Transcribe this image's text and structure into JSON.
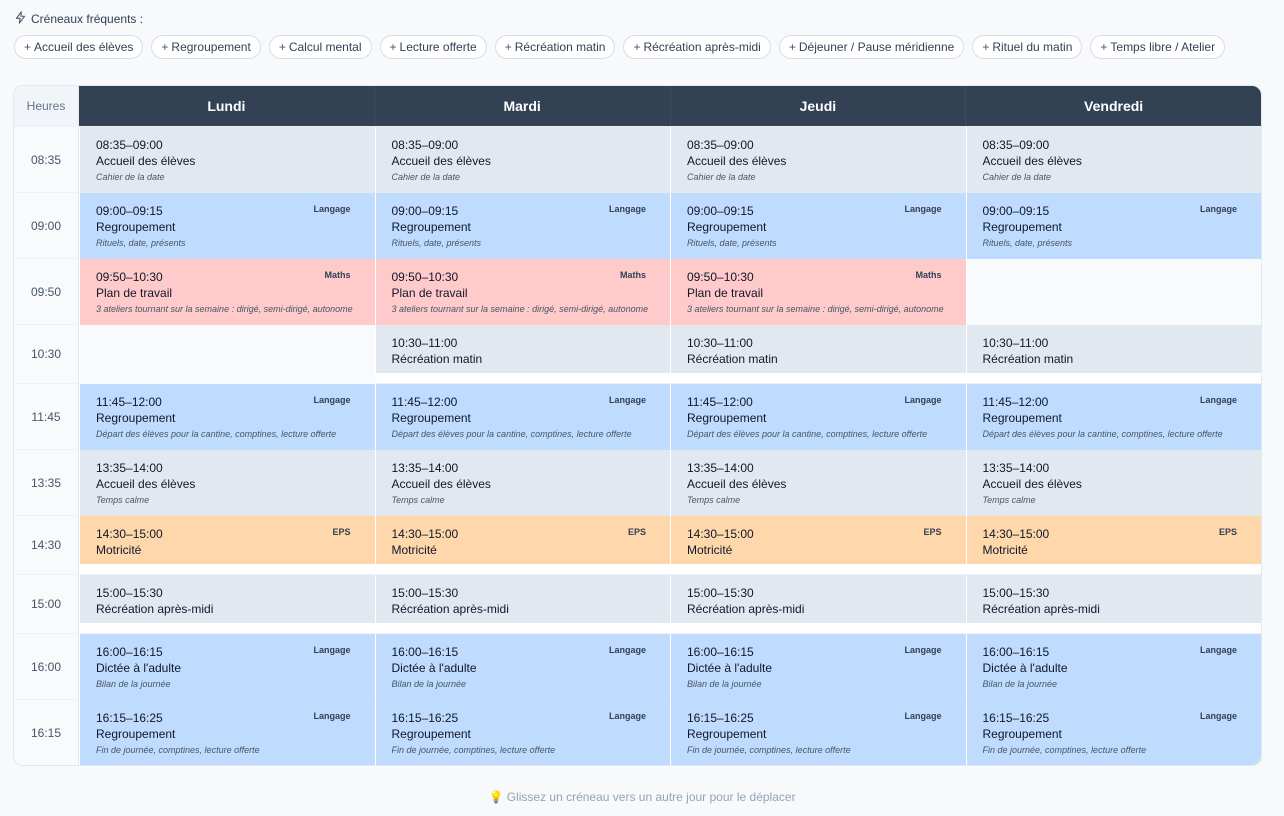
{
  "quick": {
    "title": "Créneaux fréquents :",
    "chips": [
      "Accueil des élèves",
      "Regroupement",
      "Calcul mental",
      "Lecture offerte",
      "Récréation matin",
      "Récréation après-midi",
      "Déjeuner / Pause méridienne",
      "Rituel du matin",
      "Temps libre / Atelier"
    ]
  },
  "grid": {
    "hours_label": "Heures",
    "days": [
      "Lundi",
      "Mardi",
      "Jeudi",
      "Vendredi"
    ],
    "rows": [
      {
        "time": "08:35",
        "cells": [
          {
            "time": "08:35–09:00",
            "name": "Accueil des élèves",
            "desc": "Cahier de la date",
            "tag": "",
            "color": "grey"
          },
          {
            "time": "08:35–09:00",
            "name": "Accueil des élèves",
            "desc": "Cahier de la date",
            "tag": "",
            "color": "grey"
          },
          {
            "time": "08:35–09:00",
            "name": "Accueil des élèves",
            "desc": "Cahier de la date",
            "tag": "",
            "color": "grey"
          },
          {
            "time": "08:35–09:00",
            "name": "Accueil des élèves",
            "desc": "Cahier de la date",
            "tag": "",
            "color": "grey"
          }
        ]
      },
      {
        "time": "09:00",
        "cells": [
          {
            "time": "09:00–09:15",
            "name": "Regroupement",
            "desc": "Rituels, date, présents",
            "tag": "Langage",
            "color": "blue"
          },
          {
            "time": "09:00–09:15",
            "name": "Regroupement",
            "desc": "Rituels, date, présents",
            "tag": "Langage",
            "color": "blue"
          },
          {
            "time": "09:00–09:15",
            "name": "Regroupement",
            "desc": "Rituels, date, présents",
            "tag": "Langage",
            "color": "blue"
          },
          {
            "time": "09:00–09:15",
            "name": "Regroupement",
            "desc": "Rituels, date, présents",
            "tag": "Langage",
            "color": "blue"
          }
        ]
      },
      {
        "time": "09:50",
        "cells": [
          {
            "time": "09:50–10:30",
            "name": "Plan de travail",
            "desc": "3 ateliers tournant sur la semaine : dirigé, semi-dirigé, autonome",
            "tag": "Maths",
            "color": "red"
          },
          {
            "time": "09:50–10:30",
            "name": "Plan de travail",
            "desc": "3 ateliers tournant sur la semaine : dirigé, semi-dirigé, autonome",
            "tag": "Maths",
            "color": "red"
          },
          {
            "time": "09:50–10:30",
            "name": "Plan de travail",
            "desc": "3 ateliers tournant sur la semaine : dirigé, semi-dirigé, autonome",
            "tag": "Maths",
            "color": "red"
          },
          null
        ]
      },
      {
        "time": "10:30",
        "cells": [
          null,
          {
            "time": "10:30–11:00",
            "name": "Récréation matin",
            "desc": "",
            "tag": "",
            "color": "grey"
          },
          {
            "time": "10:30–11:00",
            "name": "Récréation matin",
            "desc": "",
            "tag": "",
            "color": "grey"
          },
          {
            "time": "10:30–11:00",
            "name": "Récréation matin",
            "desc": "",
            "tag": "",
            "color": "grey"
          }
        ]
      },
      {
        "time": "11:45",
        "cells": [
          {
            "time": "11:45–12:00",
            "name": "Regroupement",
            "desc": "Départ des élèves pour la cantine, comptines, lecture offerte",
            "tag": "Langage",
            "color": "blue"
          },
          {
            "time": "11:45–12:00",
            "name": "Regroupement",
            "desc": "Départ des élèves pour la cantine, comptines, lecture offerte",
            "tag": "Langage",
            "color": "blue"
          },
          {
            "time": "11:45–12:00",
            "name": "Regroupement",
            "desc": "Départ des élèves pour la cantine, comptines, lecture offerte",
            "tag": "Langage",
            "color": "blue"
          },
          {
            "time": "11:45–12:00",
            "name": "Regroupement",
            "desc": "Départ des élèves pour la cantine, comptines, lecture offerte",
            "tag": "Langage",
            "color": "blue"
          }
        ]
      },
      {
        "time": "13:35",
        "cells": [
          {
            "time": "13:35–14:00",
            "name": "Accueil des élèves",
            "desc": "Temps calme",
            "tag": "",
            "color": "grey"
          },
          {
            "time": "13:35–14:00",
            "name": "Accueil des élèves",
            "desc": "Temps calme",
            "tag": "",
            "color": "grey"
          },
          {
            "time": "13:35–14:00",
            "name": "Accueil des élèves",
            "desc": "Temps calme",
            "tag": "",
            "color": "grey"
          },
          {
            "time": "13:35–14:00",
            "name": "Accueil des élèves",
            "desc": "Temps calme",
            "tag": "",
            "color": "grey"
          }
        ]
      },
      {
        "time": "14:30",
        "cells": [
          {
            "time": "14:30–15:00",
            "name": "Motricité",
            "desc": "",
            "tag": "EPS",
            "color": "orange"
          },
          {
            "time": "14:30–15:00",
            "name": "Motricité",
            "desc": "",
            "tag": "EPS",
            "color": "orange"
          },
          {
            "time": "14:30–15:00",
            "name": "Motricité",
            "desc": "",
            "tag": "EPS",
            "color": "orange"
          },
          {
            "time": "14:30–15:00",
            "name": "Motricité",
            "desc": "",
            "tag": "EPS",
            "color": "orange"
          }
        ]
      },
      {
        "time": "15:00",
        "cells": [
          {
            "time": "15:00–15:30",
            "name": "Récréation après-midi",
            "desc": "",
            "tag": "",
            "color": "grey"
          },
          {
            "time": "15:00–15:30",
            "name": "Récréation après-midi",
            "desc": "",
            "tag": "",
            "color": "grey"
          },
          {
            "time": "15:00–15:30",
            "name": "Récréation après-midi",
            "desc": "",
            "tag": "",
            "color": "grey"
          },
          {
            "time": "15:00–15:30",
            "name": "Récréation après-midi",
            "desc": "",
            "tag": "",
            "color": "grey"
          }
        ]
      },
      {
        "time": "16:00",
        "cells": [
          {
            "time": "16:00–16:15",
            "name": "Dictée à l'adulte",
            "desc": "Bilan de la journée",
            "tag": "Langage",
            "color": "blue"
          },
          {
            "time": "16:00–16:15",
            "name": "Dictée à l'adulte",
            "desc": "Bilan de la journée",
            "tag": "Langage",
            "color": "blue"
          },
          {
            "time": "16:00–16:15",
            "name": "Dictée à l'adulte",
            "desc": "Bilan de la journée",
            "tag": "Langage",
            "color": "blue"
          },
          {
            "time": "16:00–16:15",
            "name": "Dictée à l'adulte",
            "desc": "Bilan de la journée",
            "tag": "Langage",
            "color": "blue"
          }
        ]
      },
      {
        "time": "16:15",
        "cells": [
          {
            "time": "16:15–16:25",
            "name": "Regroupement",
            "desc": "Fin de journée, comptines, lecture offerte",
            "tag": "Langage",
            "color": "blue"
          },
          {
            "time": "16:15–16:25",
            "name": "Regroupement",
            "desc": "Fin de journée, comptines, lecture offerte",
            "tag": "Langage",
            "color": "blue"
          },
          {
            "time": "16:15–16:25",
            "name": "Regroupement",
            "desc": "Fin de journée, comptines, lecture offerte",
            "tag": "Langage",
            "color": "blue"
          },
          {
            "time": "16:15–16:25",
            "name": "Regroupement",
            "desc": "Fin de journée, comptines, lecture offerte",
            "tag": "Langage",
            "color": "blue"
          }
        ]
      }
    ]
  },
  "hint": {
    "text": "Glissez un créneau vers un autre jour pour le déplacer"
  }
}
